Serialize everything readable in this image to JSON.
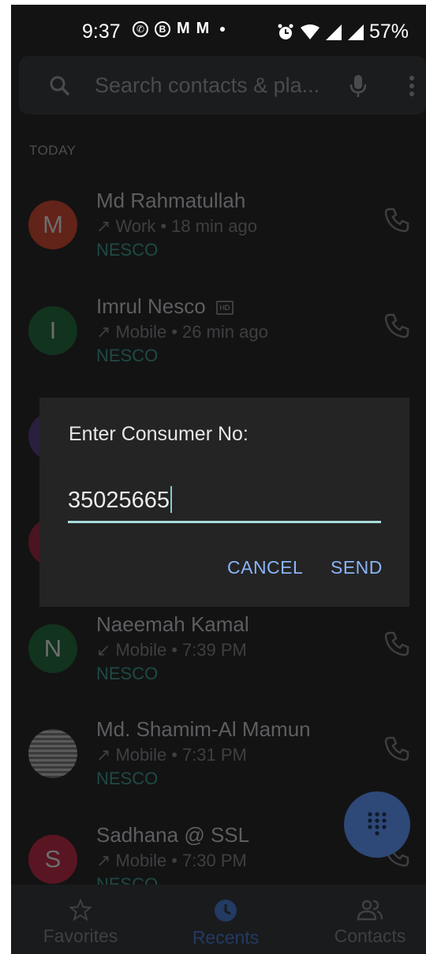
{
  "status_bar": {
    "time": "9:37",
    "battery": "57%"
  },
  "search": {
    "placeholder": "Search contacts & pla..."
  },
  "section_label": "TODAY",
  "calls": [
    {
      "initial": "M",
      "name": "Md Rahmatullah",
      "direction": "↗",
      "type": "Work",
      "when": "18 min ago",
      "tag": "NESCO",
      "avatar_color": "#622319",
      "hd": false
    },
    {
      "initial": "I",
      "name": "Imrul Nesco",
      "direction": "↗",
      "type": "Mobile",
      "when": "26 min ago",
      "tag": "NESCO",
      "avatar_color": "#12331d",
      "hd": true
    },
    {
      "initial": "N",
      "name": "Naeemah Kamal",
      "direction": "↙",
      "type": "Mobile",
      "when": "7:39 PM",
      "tag": "NESCO",
      "avatar_color": "#12331d",
      "hd": false
    },
    {
      "initial": "",
      "name": "Md. Shamim-Al Mamun",
      "direction": "↗",
      "type": "Mobile",
      "when": "7:31 PM",
      "tag": "NESCO",
      "avatar_color": "#4a4a4a",
      "hd": false
    },
    {
      "initial": "S",
      "name": "Sadhana @ SSL",
      "direction": "↗",
      "type": "Mobile",
      "when": "7:30 PM",
      "tag": "NESCO",
      "avatar_color": "#5a1522",
      "hd": false
    }
  ],
  "dialog": {
    "title": "Enter Consumer No:",
    "value": "35025665",
    "cancel_label": "CANCEL",
    "send_label": "SEND"
  },
  "bottom_nav": {
    "favorites": "Favorites",
    "recents": "Recents",
    "contacts": "Contacts",
    "active": "recents"
  },
  "colors": {
    "accent": "#8ab4f8",
    "input_underline": "#a7dcdb",
    "scrim": "#131313"
  }
}
